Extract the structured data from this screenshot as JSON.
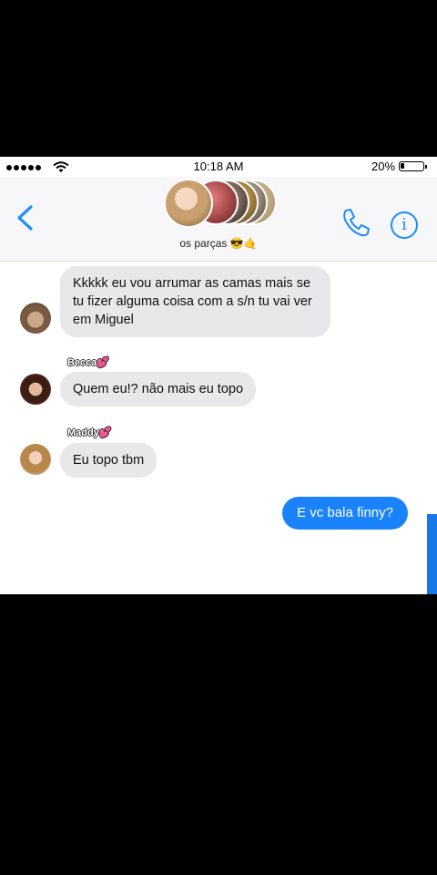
{
  "status_bar": {
    "time": "10:18 AM",
    "battery": "20%",
    "battery_level": 0.2
  },
  "header": {
    "group_name": "os parças 😎🤙",
    "back_icon": "chevron-left-icon",
    "call_icon": "phone-icon",
    "info_icon": "info-icon",
    "info_glyph": "i"
  },
  "messages": [
    {
      "text": "Kkkkk eu vou arrumar as camas mais se tu fizer alguma coisa com a s/n tu vai ver em Miguel",
      "direction": "incoming"
    },
    {
      "sender": "Becca💕",
      "text": "Quem eu!? não mais eu topo",
      "direction": "incoming"
    },
    {
      "sender": "Maddy💕",
      "text": "Eu topo tbm",
      "direction": "incoming"
    },
    {
      "text": "E vc bala finny?",
      "direction": "outgoing"
    }
  ],
  "colors": {
    "accent": "#1a8cff",
    "incoming_bubble": "#e8e8ea",
    "outgoing_bubble": "#1a82fb",
    "background": "#000000"
  }
}
